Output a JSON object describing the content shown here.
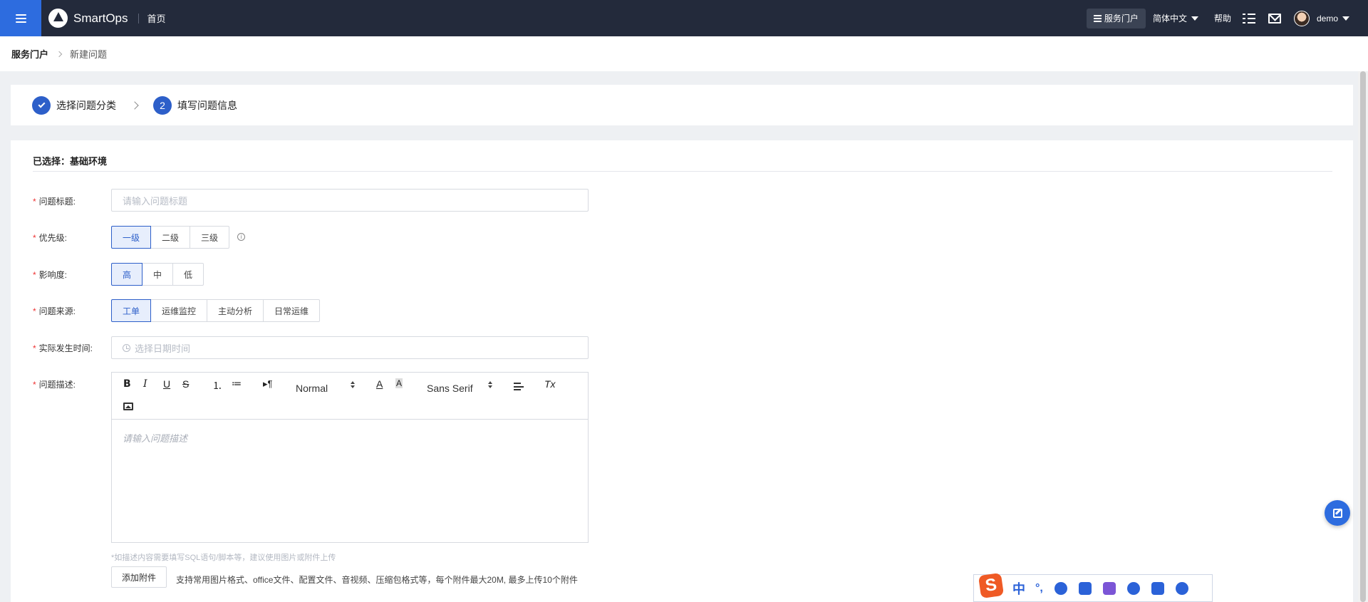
{
  "app": {
    "name": "SmartOps",
    "home": "首页"
  },
  "topnav": {
    "portal": "服务门户",
    "language": "简体中文",
    "help": "帮助",
    "user": "demo"
  },
  "breadcrumb": {
    "root": "服务门户",
    "current": "新建问题"
  },
  "steps": [
    {
      "label": "选择问题分类",
      "state": "done"
    },
    {
      "number": "2",
      "label": "填写问题信息",
      "state": "active"
    }
  ],
  "form": {
    "selected": "已选择：基础环境",
    "title": {
      "label": "问题标题:",
      "placeholder": "请输入问题标题"
    },
    "priority": {
      "label": "优先级:",
      "options": [
        "一级",
        "二级",
        "三级"
      ],
      "selected": "一级",
      "info_icon": "i"
    },
    "impact": {
      "label": "影响度:",
      "options": [
        "高",
        "中",
        "低"
      ],
      "selected": "高"
    },
    "source": {
      "label": "问题来源:",
      "options": [
        "工单",
        "运维监控",
        "主动分析",
        "日常运维"
      ],
      "selected": "工单"
    },
    "occur_time": {
      "label": "实际发生时间:",
      "placeholder": "选择日期时间"
    },
    "description": {
      "label": "问题描述:",
      "toolbar": {
        "bold": "B",
        "italic": "I",
        "underline": "U",
        "strike": "S",
        "ordered_list": "⒈",
        "bullet_list": "≔",
        "direction": "▸¶",
        "size": "Normal",
        "color": "A",
        "background": "A",
        "font": "Sans Serif",
        "clean": "Tx"
      },
      "placeholder": "请输入问题描述",
      "hint": "*如描述内容需要填写SQL语句/脚本等，建议使用图片或附件上传"
    },
    "attach": {
      "button": "添加附件",
      "note": "支持常用图片格式、office文件、配置文件、音视频、压缩包格式等，每个附件最大20M, 最多上传10个附件"
    },
    "required_mark": "*"
  },
  "ime": {
    "logo": "S",
    "mode": "中",
    "punct": "°,"
  },
  "colors": {
    "accent": "#2d5fc9",
    "topbar": "#232a3b",
    "menu": "#2d6cdf",
    "required": "#e33333"
  }
}
